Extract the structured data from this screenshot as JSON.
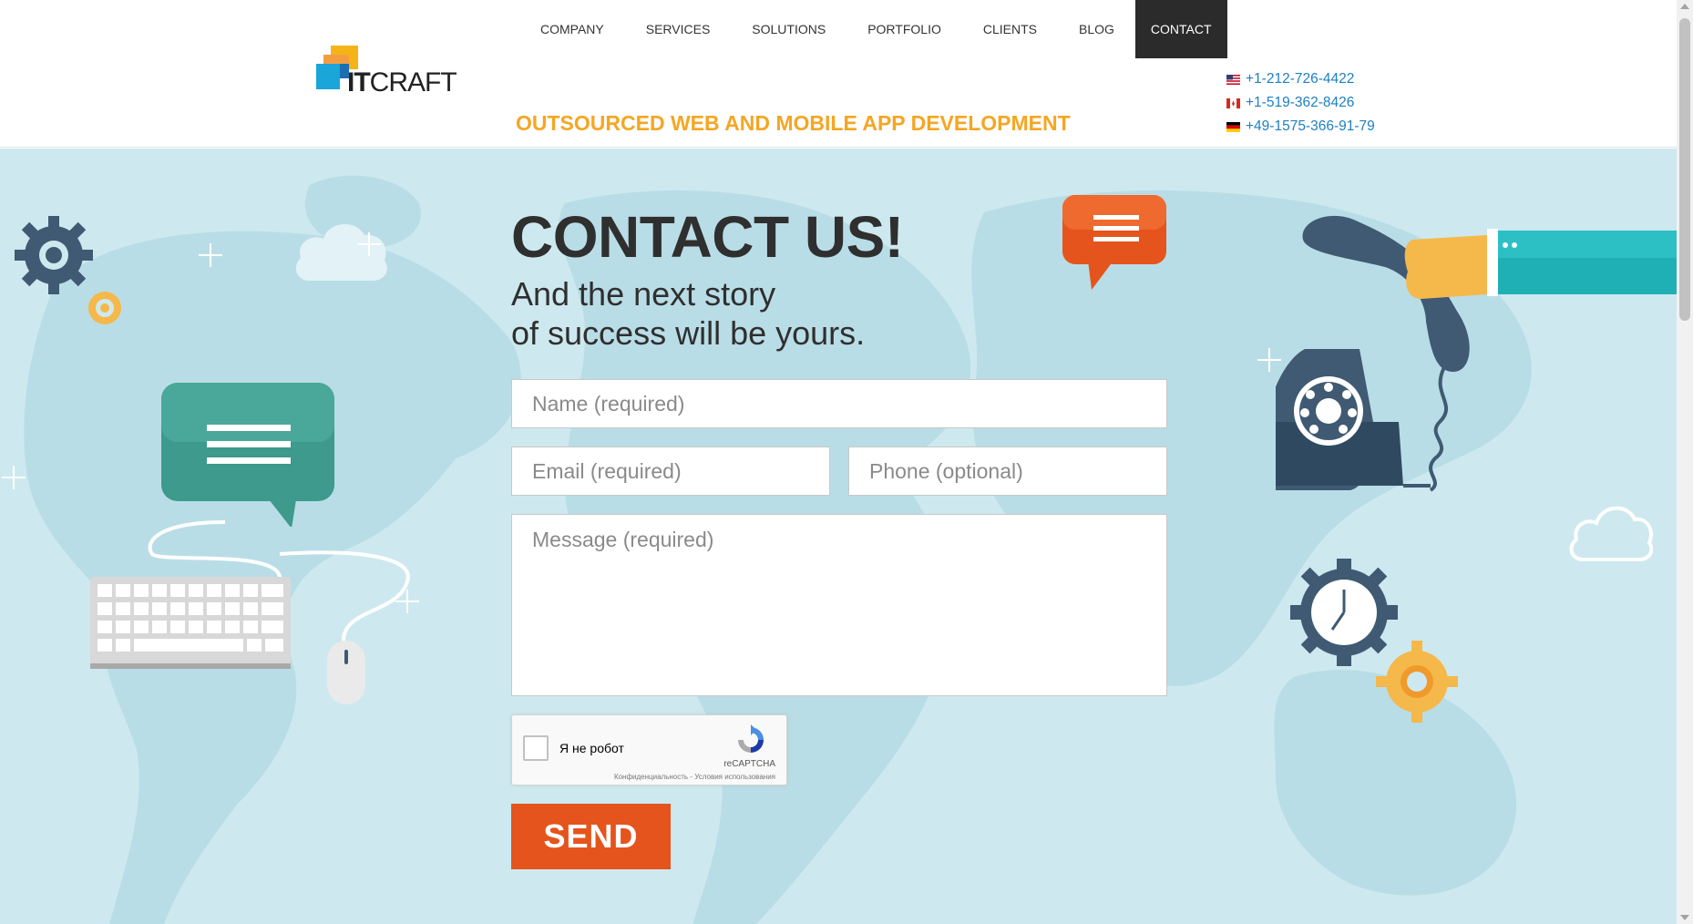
{
  "nav": {
    "items": [
      "COMPANY",
      "SERVICES",
      "SOLUTIONS",
      "PORTFOLIO",
      "CLIENTS",
      "BLOG",
      "CONTACT"
    ],
    "active": "CONTACT"
  },
  "logo": {
    "text_bold": "IT",
    "text_regular": "CRAFT"
  },
  "tagline": "OUTSOURCED WEB AND MOBILE APP DEVELOPMENT",
  "phones": [
    {
      "flag": "us-flag-icon",
      "number": "+1-212-726-4422"
    },
    {
      "flag": "canada-flag-icon",
      "number": "+1-519-362-8426"
    },
    {
      "flag": "germany-flag-icon",
      "number": "+49-1575-366-91-79"
    }
  ],
  "hero": {
    "title": "CONTACT US!",
    "subtitle_line1": "And the next story",
    "subtitle_line2": "of success will be yours."
  },
  "form": {
    "name_placeholder": "Name (required)",
    "email_placeholder": "Email (required)",
    "phone_placeholder": "Phone (optional)",
    "message_placeholder": "Message (required)",
    "send_label": "SEND"
  },
  "captcha": {
    "label": "Я не робот",
    "brand": "reCAPTCHA",
    "links": "Конфиденциальность - Условия использования"
  },
  "colors": {
    "accent_orange": "#f5a623",
    "send_button": "#e5541d",
    "hero_bg": "#cde9ef",
    "link_blue": "#1d7fc4",
    "nav_active_bg": "#2b2b2b"
  }
}
